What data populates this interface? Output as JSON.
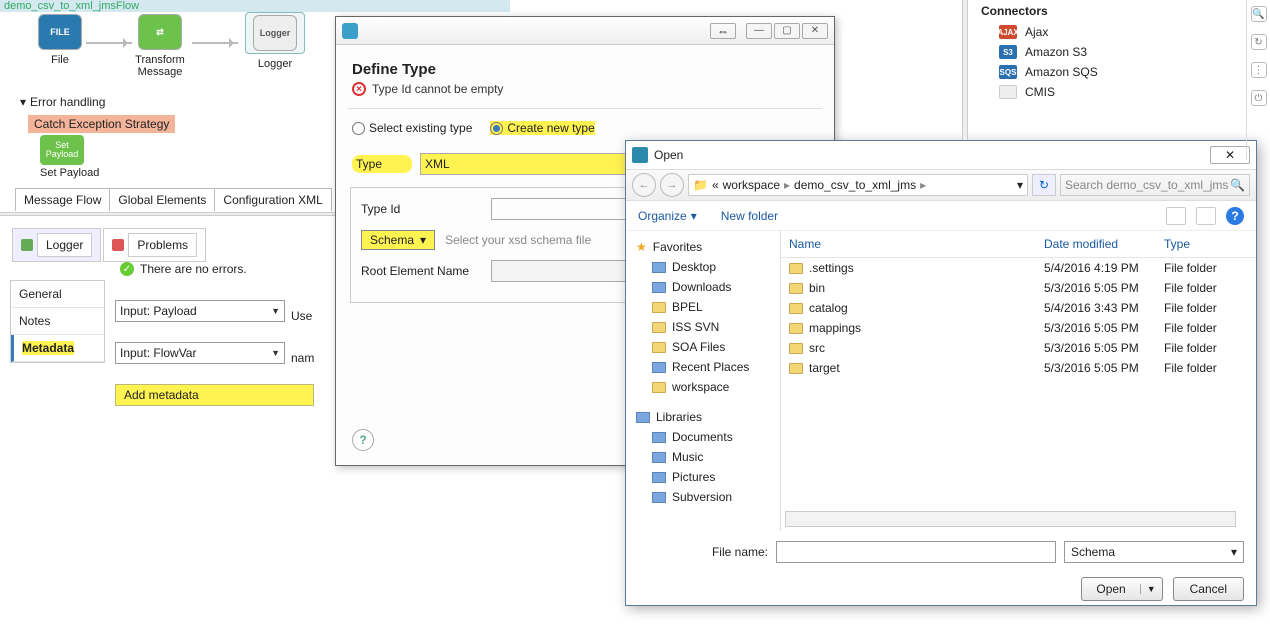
{
  "flow": {
    "title": "demo_csv_to_xml_jmsFlow",
    "nodes": {
      "file": "File",
      "transform": "Transform Message",
      "logger": "Logger"
    },
    "error_handling": "Error handling",
    "catch": "Catch Exception Strategy",
    "setpayload_box": "Set Payload",
    "setpayload_lbl": "Set Payload",
    "tabs": {
      "mf": "Message Flow",
      "ge": "Global Elements",
      "cx": "Configuration XML"
    }
  },
  "views": {
    "logger": "Logger",
    "problems": "Problems",
    "noerrors": "There are no errors."
  },
  "sidenav": {
    "general": "General",
    "notes": "Notes",
    "metadata": "Metadata"
  },
  "meta": {
    "input_payload": "Input: Payload",
    "use": "Use",
    "input_flowvar": "Input: FlowVar",
    "nam": "nam",
    "add": "Add metadata"
  },
  "dlg1": {
    "heading": "Define Type",
    "err": "Type Id cannot be empty",
    "r1": "Select existing type",
    "r2": "Create new type",
    "type_lbl": "Type",
    "type_val": "XML",
    "typeid_lbl": "Type Id",
    "schema_btn": "Schema",
    "schema_ph": "Select your xsd schema file",
    "root_lbl": "Root Element Name"
  },
  "dlg2": {
    "title": "Open",
    "bc": {
      "a": "workspace",
      "b": "demo_csv_to_xml_jms"
    },
    "search_ph": "Search demo_csv_to_xml_jms",
    "organize": "Organize",
    "newfolder": "New folder",
    "tree": {
      "fav": "Favorites",
      "items1": [
        "Desktop",
        "Downloads",
        "BPEL",
        "ISS SVN",
        "SOA Files",
        "Recent Places",
        "workspace"
      ],
      "lib": "Libraries",
      "items2": [
        "Documents",
        "Music",
        "Pictures",
        "Subversion"
      ]
    },
    "cols": {
      "name": "Name",
      "dm": "Date modified",
      "type": "Type"
    },
    "rows": [
      {
        "n": ".settings",
        "d": "5/4/2016 4:19 PM",
        "t": "File folder"
      },
      {
        "n": "bin",
        "d": "5/3/2016 5:05 PM",
        "t": "File folder"
      },
      {
        "n": "catalog",
        "d": "5/4/2016 3:43 PM",
        "t": "File folder"
      },
      {
        "n": "mappings",
        "d": "5/3/2016 5:05 PM",
        "t": "File folder"
      },
      {
        "n": "src",
        "d": "5/3/2016 5:05 PM",
        "t": "File folder"
      },
      {
        "n": "target",
        "d": "5/3/2016 5:05 PM",
        "t": "File folder"
      }
    ],
    "filename_lbl": "File name:",
    "filter": "Schema",
    "open": "Open",
    "cancel": "Cancel"
  },
  "connectors": {
    "heading": "Connectors",
    "items": [
      {
        "lbl": "Ajax",
        "bg": "#d04a2f",
        "abbr": "AJAX"
      },
      {
        "lbl": "Amazon S3",
        "bg": "#2a6fb0",
        "abbr": "S3"
      },
      {
        "lbl": "Amazon SQS",
        "bg": "#2a6fb0",
        "abbr": "SQS"
      },
      {
        "lbl": "CMIS",
        "bg": "#e8e8e8",
        "abbr": ""
      }
    ]
  }
}
